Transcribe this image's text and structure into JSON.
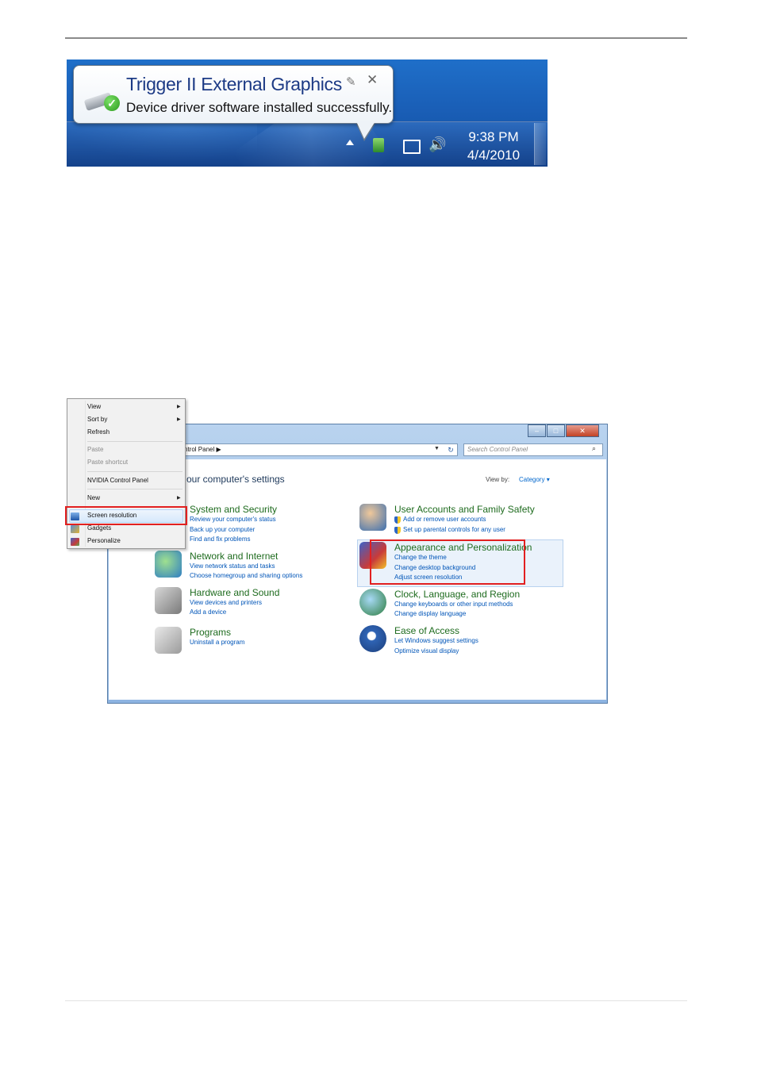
{
  "notification": {
    "title": "Trigger II External Graphics",
    "message": "Device driver software installed successfully.",
    "time": "9:38 PM",
    "date": "4/4/2010"
  },
  "context_menu": {
    "items": [
      {
        "label": "View"
      },
      {
        "label": "Sort by"
      },
      {
        "label": "Refresh"
      },
      {
        "label": "Paste"
      },
      {
        "label": "Paste shortcut"
      },
      {
        "label": "NVIDIA Control Panel"
      },
      {
        "label": "New"
      },
      {
        "label": "Screen resolution"
      },
      {
        "label": "Gadgets"
      },
      {
        "label": "Personalize"
      }
    ]
  },
  "control_panel": {
    "address": "ntrol Panel",
    "search_placeholder": "Search Control Panel",
    "heading": "our computer's settings",
    "view_by_label": "View by:",
    "view_by_value": "Category",
    "categories": [
      {
        "title": "System and Security",
        "links": [
          "Review your computer's status",
          "Back up your computer",
          "Find and fix problems"
        ]
      },
      {
        "title": "Network and Internet",
        "links": [
          "View network status and tasks",
          "Choose homegroup and sharing options"
        ]
      },
      {
        "title": "Hardware and Sound",
        "links": [
          "View devices and printers",
          "Add a device"
        ]
      },
      {
        "title": "Programs",
        "links": [
          "Uninstall a program"
        ]
      },
      {
        "title": "User Accounts and Family Safety",
        "links": [
          "Add or remove user accounts",
          "Set up parental controls for any user"
        ]
      },
      {
        "title": "Appearance and Personalization",
        "links": [
          "Change the theme",
          "Change desktop background",
          "Adjust screen resolution"
        ]
      },
      {
        "title": "Clock, Language, and Region",
        "links": [
          "Change keyboards or other input methods",
          "Change display language"
        ]
      },
      {
        "title": "Ease of Access",
        "links": [
          "Let Windows suggest settings",
          "Optimize visual display"
        ]
      }
    ]
  },
  "colors": {
    "highlight_box": "#e22020",
    "link": "#0055b8",
    "category_title": "#1e6b1e"
  }
}
